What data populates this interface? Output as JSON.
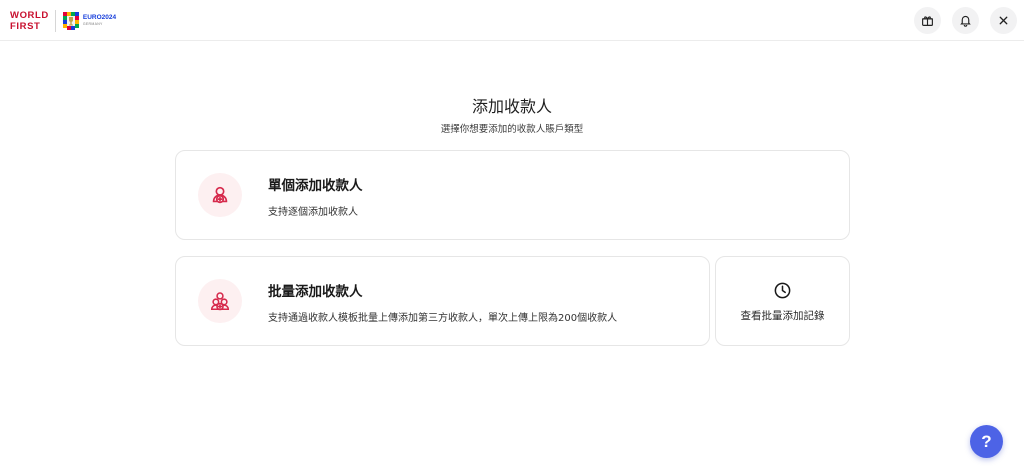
{
  "header": {
    "brand_line1": "WORLD",
    "brand_line2": "FIRST",
    "partner_text": "EURO2024",
    "partner_subtext": "GERMANY",
    "icons": [
      "gift-icon",
      "bell-icon",
      "close-icon"
    ]
  },
  "main": {
    "title": "添加收款人",
    "subtitle": "選擇你想要添加的收款人賬戶類型",
    "cards": [
      {
        "title": "單個添加收款人",
        "description": "支持逐個添加收款人",
        "icon": "single-payee-icon"
      },
      {
        "title": "批量添加收款人",
        "description": "支持通過收款人模板批量上傳添加第三方收款人，單次上傳上限為200個收款人",
        "icon": "batch-payee-icon"
      }
    ],
    "history": {
      "label": "查看批量添加記錄",
      "icon": "clock-icon"
    }
  },
  "help": {
    "label": "?"
  },
  "colors": {
    "brand_red": "#c8102e",
    "icon_red": "#d62a4c",
    "icon_badge_bg": "#fdf0f1",
    "help_blue": "#4d63e6"
  }
}
